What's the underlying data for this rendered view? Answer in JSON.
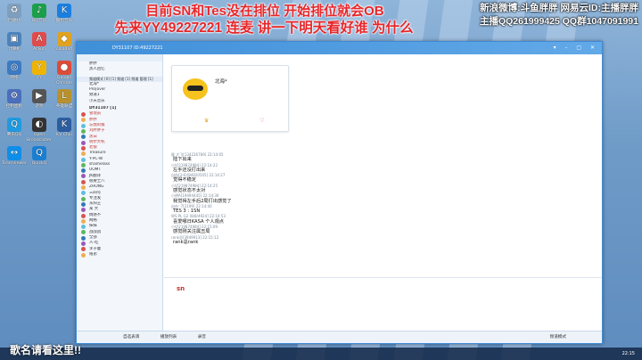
{
  "overlay": {
    "title_line1": "目前SN和Tes没在排位   开始排位就会OB",
    "title_line2": "先来YY49227221 连麦  讲一下明天看好谁 为什么",
    "weibo": "新浪微博:斗鱼胖胖   网易云ID:主播胖胖",
    "qq": "主播QQ261999425 QQ群1047091991",
    "bottom_text": "歌名请看这里!!"
  },
  "desktop_icons": [
    {
      "label": "回收站",
      "color": "#7f9fbf",
      "glyph": "♻"
    },
    {
      "label": "QQ音乐",
      "color": "#1b9f4a",
      "glyph": "♪"
    },
    {
      "label": "酷狗音乐",
      "color": "#1a7fe0",
      "glyph": "K"
    },
    {
      "label": "计算机",
      "color": "#4b83bd",
      "glyph": "▣"
    },
    {
      "label": "AcFun",
      "color": "#e04b4b",
      "glyph": "A"
    },
    {
      "label": "oloaded",
      "color": "#e0a21f",
      "glyph": "◆"
    },
    {
      "label": "网络",
      "color": "#3c7bc4",
      "glyph": "◎"
    },
    {
      "label": "YY",
      "color": "#f0b400",
      "glyph": "Y"
    },
    {
      "label": "Google Chrome",
      "color": "#dd4b39",
      "glyph": "●"
    },
    {
      "label": "控制面板",
      "color": "#4b6fbd",
      "glyph": "⚙"
    },
    {
      "label": "游戏",
      "color": "#555",
      "glyph": "▶"
    },
    {
      "label": "英雄联盟",
      "color": "#b8912f",
      "glyph": "L"
    },
    {
      "label": "腾讯QQ",
      "color": "#1f9ae0",
      "glyph": "Q"
    },
    {
      "label": "Open Broadcaster",
      "color": "#333",
      "glyph": "◐"
    },
    {
      "label": "KV Choi",
      "color": "#2c5da0",
      "glyph": "K"
    },
    {
      "label": "TeamViewer",
      "color": "#0e8ee9",
      "glyph": "↔"
    },
    {
      "label": "QuickQ",
      "color": "#1b7fd1",
      "glyph": "Q"
    }
  ],
  "window": {
    "title": "DY31107  ID:49227221",
    "left_top": [
      "胖胖",
      "黑人回忆"
    ],
    "channel_header": "频道模式  [0] [1] 频道 [1] 频道 管理 [1]",
    "sub_channels": [
      "北海*",
      "Pro|over",
      "频道1",
      "小天音乐"
    ],
    "member_header": "DY31107 [1]",
    "members": [
      "管理员",
      "胖胖",
      "忘我的猴",
      "刘胖胖子",
      "黑白",
      "明尔大机",
      "老狼",
      "Treasure",
      "Y-PC-W",
      "shamelass",
      "UOMT",
      "JK翻译",
      "很要士八",
      "ZHONG",
      "三四号",
      "专注发",
      "东阳王",
      "某 大",
      "情感不",
      "网络",
      "抹抹",
      "战战战",
      "全部",
      "人-吃",
      "李子童",
      "陆弟"
    ],
    "card_name": "北海*",
    "chat": [
      {
        "meta": "胖 大飞[134226789] 22:14:05",
        "msg": "陆下出来"
      },
      {
        "meta": "小V[219874984] 22:14:22",
        "msg": "左手还没打出来"
      },
      {
        "meta": "自由(3-6)[84920505] 22:14:27",
        "msg": "觉得不稳定"
      },
      {
        "meta": "小V[219874984] 22:14:25",
        "msg": "感觉状态不太对"
      },
      {
        "meta": "小明A[19494445] 22:14:30",
        "msg": "我觉得左手后2局打出感觉了"
      },
      {
        "meta": "自在: 7[2199] 22:14:40",
        "msg": "TES 3 : 1SN"
      },
      {
        "meta": "WS PL G2 [8/8/4924] 22:14:53",
        "msg": "喜爱哪日KASA 个人观点"
      },
      {
        "meta": "小V[219874984] 22:15:09",
        "msg": "感觉刚关注属丑局"
      },
      {
        "meta": "rank总[3949913] 22:15:12",
        "msg": "rank总rank"
      }
    ],
    "input_text": "sn",
    "bottom_bar": [
      "自选表演",
      "播放列表",
      "录音"
    ],
    "bottom_right": "频道模式"
  },
  "clock": "22:15"
}
